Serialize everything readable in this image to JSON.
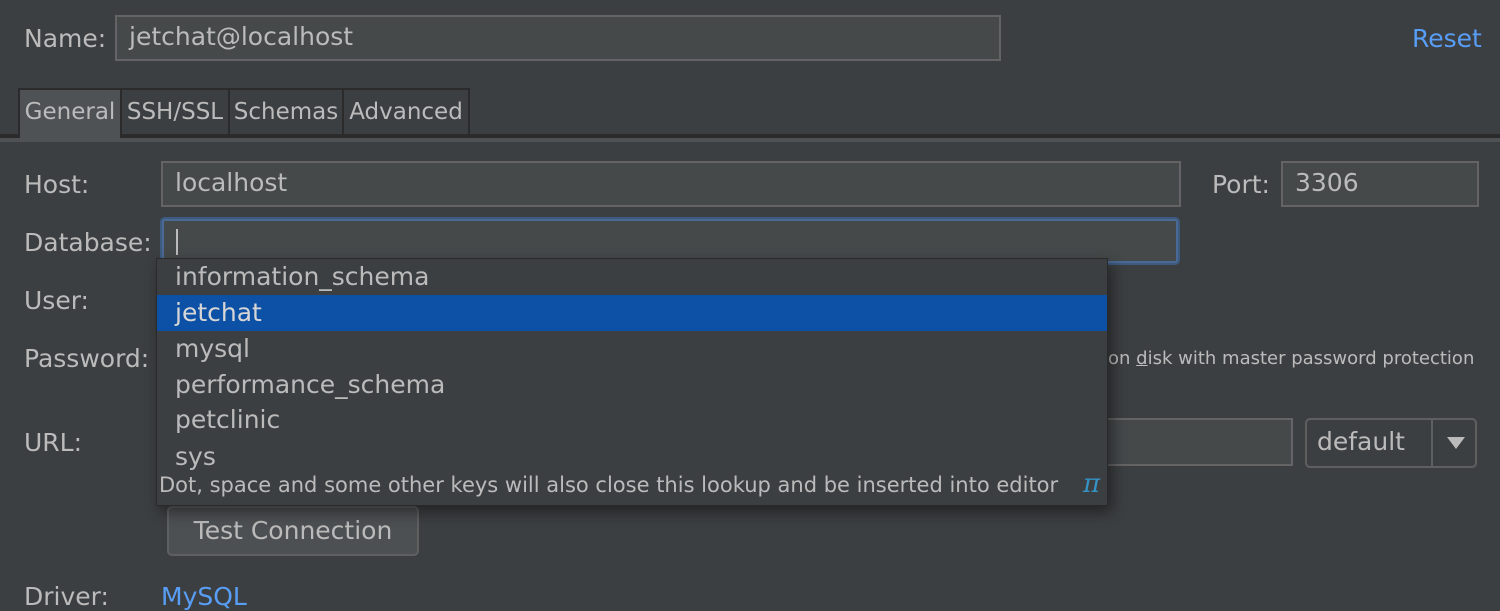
{
  "name_field": {
    "label": "Name:",
    "value": "jetchat@localhost"
  },
  "reset_link": "Reset",
  "tabs": [
    {
      "label": "General",
      "active": true
    },
    {
      "label": "SSH/SSL",
      "active": false
    },
    {
      "label": "Schemas",
      "active": false
    },
    {
      "label": "Advanced",
      "active": false
    }
  ],
  "host": {
    "label": "Host:",
    "value": "localhost"
  },
  "port": {
    "label": "Port:",
    "value": "3306"
  },
  "database": {
    "label": "Database:",
    "value": ""
  },
  "user": {
    "label": "User:"
  },
  "password": {
    "label": "Password:",
    "save_option_prefix": "on ",
    "save_option_mnemonic": "d",
    "save_option_suffix": "isk with master password protection"
  },
  "url": {
    "label": "URL:",
    "value": "",
    "mode": "default"
  },
  "lookup": {
    "items": [
      "information_schema",
      "jetchat",
      "mysql",
      "performance_schema",
      "petclinic",
      "sys"
    ],
    "selected_index": 1,
    "hint": "Dot, space and some other keys will also close this lookup and be inserted into editor",
    "hint_icon": "π"
  },
  "test_connection_button": "Test Connection",
  "driver": {
    "label": "Driver:",
    "value": "MySQL"
  },
  "colors": {
    "background": "#3c3f41",
    "link": "#589df6",
    "selection": "#0d51a6",
    "focus_border": "#4a6a95"
  }
}
